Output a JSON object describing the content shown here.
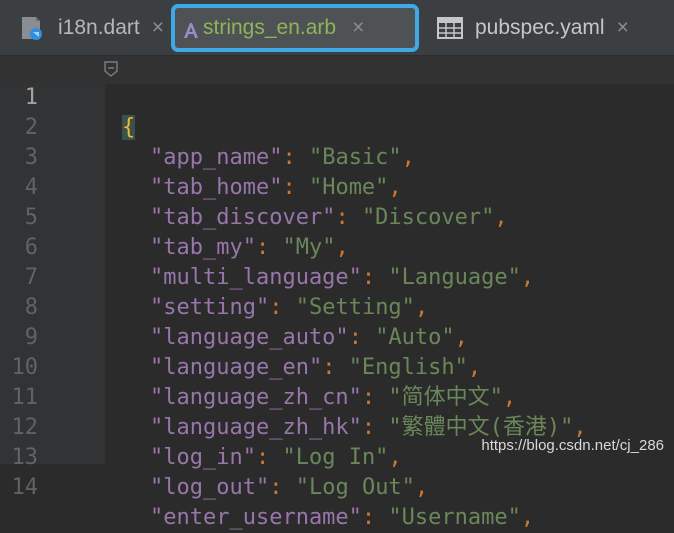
{
  "tabs": [
    {
      "label": "i18n.dart",
      "close": "×"
    },
    {
      "label": "strings_en.arb",
      "close": "×"
    },
    {
      "label": "pubspec.yaml",
      "close": "×"
    }
  ],
  "colors": {
    "active_tab_border": "#3fa9e6",
    "key": "#9876aa",
    "string": "#6a8759",
    "brace": "#e8ba36"
  },
  "editor": {
    "open_brace": "{",
    "lines": [
      {
        "num": "1"
      },
      {
        "num": "2",
        "key": "\"app_name\"",
        "value": "\"Basic\""
      },
      {
        "num": "3",
        "key": "\"tab_home\"",
        "value": "\"Home\""
      },
      {
        "num": "4",
        "key": "\"tab_discover\"",
        "value": "\"Discover\""
      },
      {
        "num": "5",
        "key": "\"tab_my\"",
        "value": "\"My\""
      },
      {
        "num": "6",
        "key": "\"multi_language\"",
        "value": "\"Language\""
      },
      {
        "num": "7",
        "key": "\"setting\"",
        "value": "\"Setting\""
      },
      {
        "num": "8",
        "key": "\"language_auto\"",
        "value": "\"Auto\""
      },
      {
        "num": "9",
        "key": "\"language_en\"",
        "value": "\"English\""
      },
      {
        "num": "10",
        "key": "\"language_zh_cn\"",
        "value": "\"简体中文\""
      },
      {
        "num": "11",
        "key": "\"language_zh_hk\"",
        "value": "\"繁體中文(香港)\""
      },
      {
        "num": "12",
        "key": "\"log_in\"",
        "value": "\"Log In\""
      },
      {
        "num": "13",
        "key": "\"log_out\"",
        "value": "\"Log Out\""
      },
      {
        "num": "14",
        "key": "\"enter_username\"",
        "value": "\"Username\""
      }
    ],
    "colon": ": ",
    "comma": ","
  },
  "watermark": "https://blog.csdn.net/cj_286"
}
